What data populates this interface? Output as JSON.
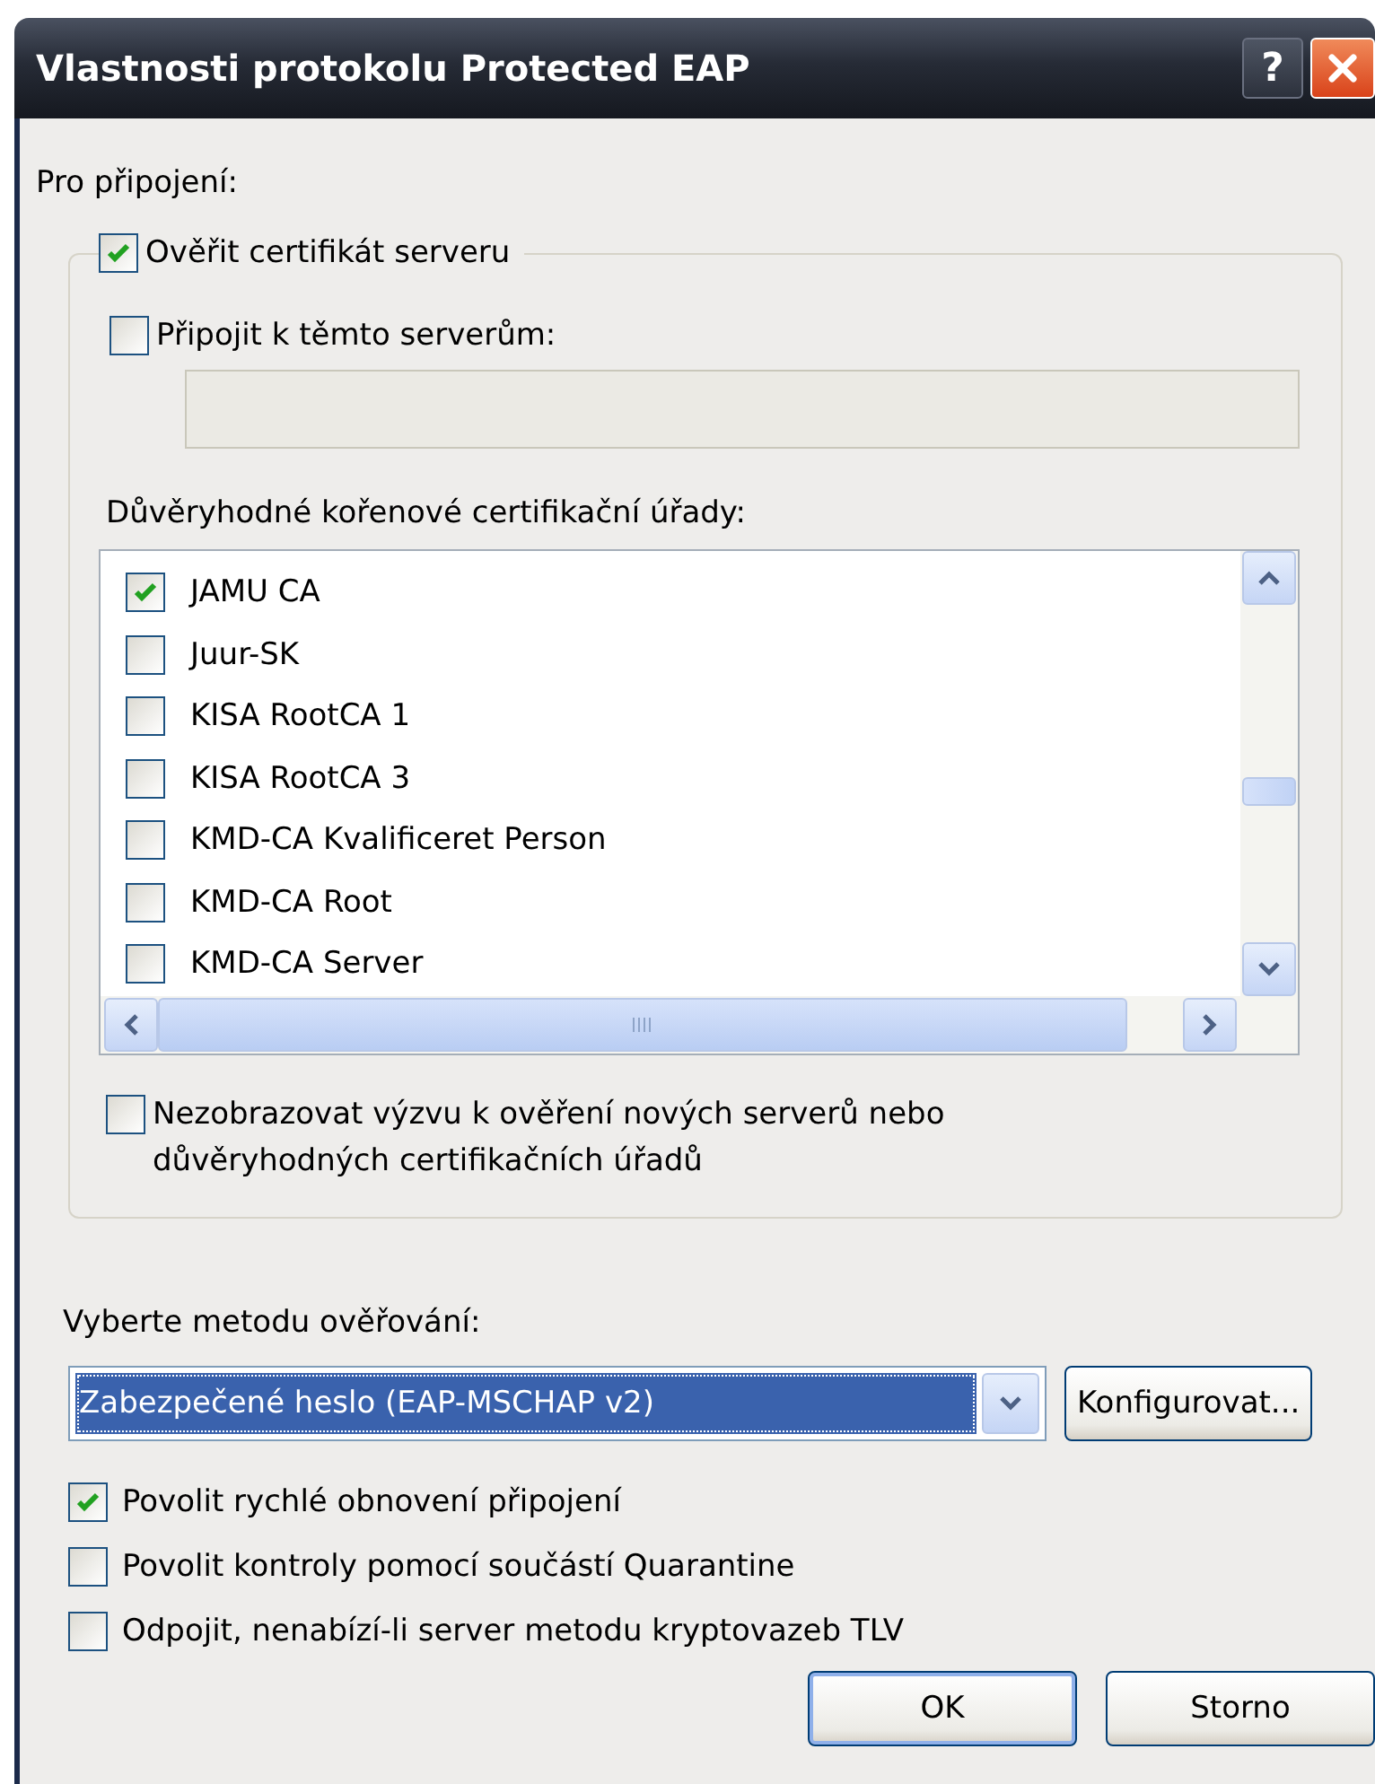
{
  "window": {
    "title": "Vlastnosti protokolu Protected EAP",
    "help_button": "?"
  },
  "connection_label": "Pro připojení:",
  "validate_certificate": {
    "label": "Ověřit certifikát serveru",
    "checked": true
  },
  "connect_to_servers": {
    "label": "Připojit k těmto serverům:",
    "checked": false,
    "field_disabled": true
  },
  "trusted_roots": {
    "label": "Důvěryhodné kořenové certifikační úřady:",
    "items": [
      {
        "label": "JAMU CA",
        "checked": true
      },
      {
        "label": "Juur-SK",
        "checked": false
      },
      {
        "label": "KISA RootCA 1",
        "checked": false
      },
      {
        "label": "KISA RootCA 3",
        "checked": false
      },
      {
        "label": "KMD-CA Kvalificeret Person",
        "checked": false
      },
      {
        "label": "KMD-CA Root",
        "checked": false
      },
      {
        "label": "KMD-CA Server",
        "checked": false
      }
    ]
  },
  "no_prompt": {
    "label": "Nezobrazovat výzvu k ověření nových serverů nebo důvěryhodných certifikačních úřadů",
    "checked": false
  },
  "method": {
    "label": "Vyberte metodu ověřování:",
    "value": "Zabezpečené heslo (EAP-MSCHAP v2)",
    "focused": true,
    "configure_button": "Konfigurovat..."
  },
  "options": [
    {
      "label": "Povolit rychlé obnovení připojení",
      "checked": true
    },
    {
      "label": "Povolit kontroly pomocí součástí Quarantine",
      "checked": false
    },
    {
      "label": "Odpojit, nenabízí-li server metodu kryptovazeb TLV",
      "checked": false
    }
  ],
  "buttons": [
    {
      "label": "OK",
      "default": true
    },
    {
      "label": "Storno",
      "default": false
    }
  ]
}
